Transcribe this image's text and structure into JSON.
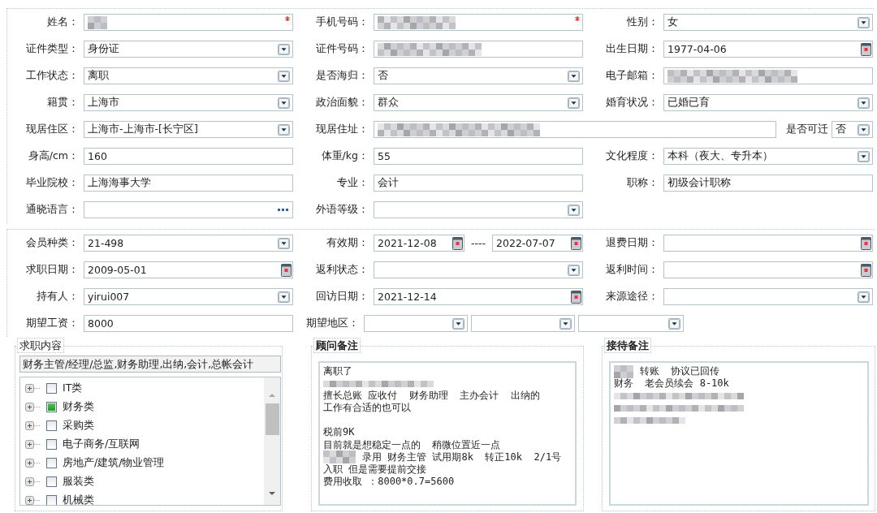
{
  "personal": {
    "rows": [
      [
        {
          "label": "姓名：",
          "kind": "text",
          "redacted": true,
          "required": true
        },
        {
          "label": "手机号码：",
          "kind": "text",
          "redacted": true,
          "required": true
        },
        {
          "label": "性别：",
          "kind": "select",
          "value": "女"
        }
      ],
      [
        {
          "label": "证件类型：",
          "kind": "select",
          "value": "身份证"
        },
        {
          "label": "证件号码：",
          "kind": "text",
          "redacted": true
        },
        {
          "label": "出生日期：",
          "kind": "date",
          "value": "1977-04-06"
        }
      ],
      [
        {
          "label": "工作状态：",
          "kind": "select",
          "value": "离职"
        },
        {
          "label": "是否海归：",
          "kind": "select",
          "value": "否"
        },
        {
          "label": "电子邮箱：",
          "kind": "text",
          "redacted": true
        }
      ],
      [
        {
          "label": "籍贯：",
          "kind": "select",
          "value": "上海市"
        },
        {
          "label": "政治面貌：",
          "kind": "select",
          "value": "群众"
        },
        {
          "label": "婚育状况：",
          "kind": "select",
          "value": "已婚已育"
        }
      ],
      [
        {
          "label": "现居住区：",
          "kind": "select",
          "value": "上海市-上海市-[长宁区]"
        },
        {
          "label": "现居住址：",
          "kind": "wide",
          "redacted": true,
          "extra": {
            "label": "是否可迁",
            "kind": "select",
            "value": "否"
          }
        }
      ],
      [
        {
          "label": "身高/cm：",
          "kind": "text",
          "value": "160"
        },
        {
          "label": "体重/kg：",
          "kind": "text",
          "value": "55"
        },
        {
          "label": "文化程度：",
          "kind": "select",
          "value": "本科（夜大、专升本）"
        }
      ],
      [
        {
          "label": "毕业院校：",
          "kind": "text",
          "value": "上海海事大学"
        },
        {
          "label": "专业：",
          "kind": "text",
          "value": "会计"
        },
        {
          "label": "职称：",
          "kind": "text",
          "value": "初级会计职称"
        }
      ],
      [
        {
          "label": "通晓语言：",
          "kind": "picker"
        },
        {
          "label": "外语等级：",
          "kind": "select"
        }
      ]
    ]
  },
  "membership": {
    "rows": [
      [
        {
          "label": "会员种类：",
          "kind": "select",
          "value": "21-498"
        },
        {
          "label": "有效期：",
          "kind": "date_range",
          "from": "2021-12-08",
          "separator": "----",
          "to": "2022-07-07"
        },
        {
          "label": "退费日期：",
          "kind": "date"
        }
      ],
      [
        {
          "label": "求职日期：",
          "kind": "date",
          "value": "2009-05-01"
        },
        {
          "label": "返利状态：",
          "kind": "select"
        },
        {
          "label": "返利时间：",
          "kind": "date"
        }
      ],
      [
        {
          "label": "持有人：",
          "kind": "select",
          "value": "yirui007"
        },
        {
          "label": "回访日期：",
          "kind": "date",
          "value": "2021-12-14"
        },
        {
          "label": "来源途径：",
          "kind": "select"
        }
      ],
      [
        {
          "label": "期望工资：",
          "kind": "text",
          "value": "8000"
        },
        {
          "label": "期望地区：",
          "kind": "region",
          "selects": [
            {
              "kind": "select"
            },
            {
              "kind": "select"
            },
            {
              "kind": "select"
            }
          ]
        }
      ]
    ]
  },
  "groups": [
    {
      "kind": "tree",
      "title": "求职内容",
      "summary": "财务主管/经理/总监,财务助理,出纳,会计,总帐会计",
      "items": [
        {
          "label": "IT类",
          "checked": false
        },
        {
          "label": "财务类",
          "checked": true
        },
        {
          "label": "采购类",
          "checked": false
        },
        {
          "label": "电子商务/互联网",
          "checked": false
        },
        {
          "label": "房地产/建筑/物业管理",
          "checked": false
        },
        {
          "label": "服装类",
          "checked": false
        },
        {
          "label": "机械类",
          "checked": false
        }
      ]
    },
    {
      "kind": "notes",
      "title": "顾问备注",
      "lines": [
        {
          "kind": "text",
          "text": "离职了"
        },
        {
          "kind": "redacted"
        },
        {
          "kind": "text",
          "text": "擅长总账 应收付  财务助理  主办会计  出纳的"
        },
        {
          "kind": "text",
          "text": "工作有合适的也可以"
        },
        {
          "kind": "blank"
        },
        {
          "kind": "text",
          "text": "税前9K"
        },
        {
          "kind": "text",
          "text": "目前就是想稳定一点的  稍微位置近一点"
        },
        {
          "kind": "redacted_prefix",
          "text": "录用 财务主管 试用期8k  转正10k  2/1号"
        },
        {
          "kind": "text",
          "text": "入职 但是需要提前交接"
        },
        {
          "kind": "text",
          "text": "费用收取 ：8000*0.7=5600"
        }
      ]
    },
    {
      "kind": "notes",
      "title": "接待备注",
      "lines": [
        {
          "kind": "redacted_prefix",
          "text": "转账  协议已回传"
        },
        {
          "kind": "text",
          "text": "财务  老会员续会 8-10k"
        },
        {
          "kind": "redacted"
        },
        {
          "kind": "redacted"
        },
        {
          "kind": "redacted"
        }
      ]
    }
  ]
}
